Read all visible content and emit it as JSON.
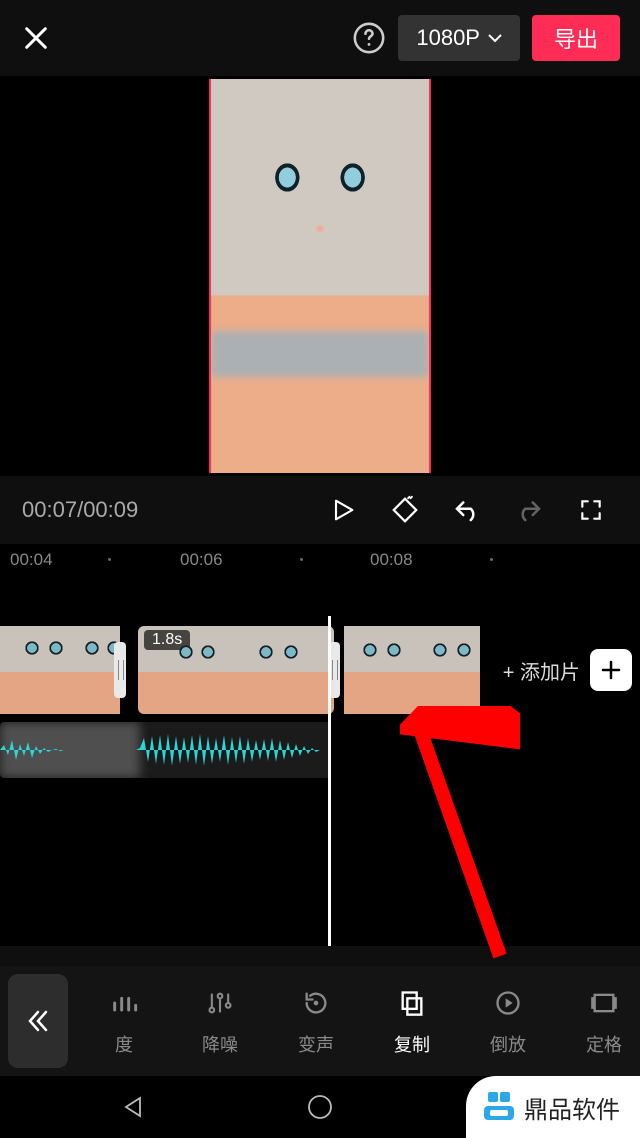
{
  "topbar": {
    "resolution_label": "1080P",
    "export_label": "导出"
  },
  "playback": {
    "current_time": "00:07",
    "total_time": "00:09"
  },
  "ruler": {
    "ticks": [
      "00:04",
      "00:06",
      "00:08"
    ]
  },
  "timeline": {
    "clip2_duration": "1.8s",
    "add_segment_label": "+ 添加片"
  },
  "toolbar": {
    "items": [
      {
        "key": "speed",
        "label": "度",
        "icon": "bars",
        "active": false
      },
      {
        "key": "denoise",
        "label": "降噪",
        "icon": "equalizer",
        "active": false
      },
      {
        "key": "voice",
        "label": "变声",
        "icon": "refresh",
        "active": false
      },
      {
        "key": "copy",
        "label": "复制",
        "icon": "copy",
        "active": true
      },
      {
        "key": "reverse",
        "label": "倒放",
        "icon": "playcircle",
        "active": false
      },
      {
        "key": "freeze",
        "label": "定格",
        "icon": "slideshow",
        "active": false
      }
    ]
  },
  "watermark": {
    "text": "鼎品软件"
  }
}
